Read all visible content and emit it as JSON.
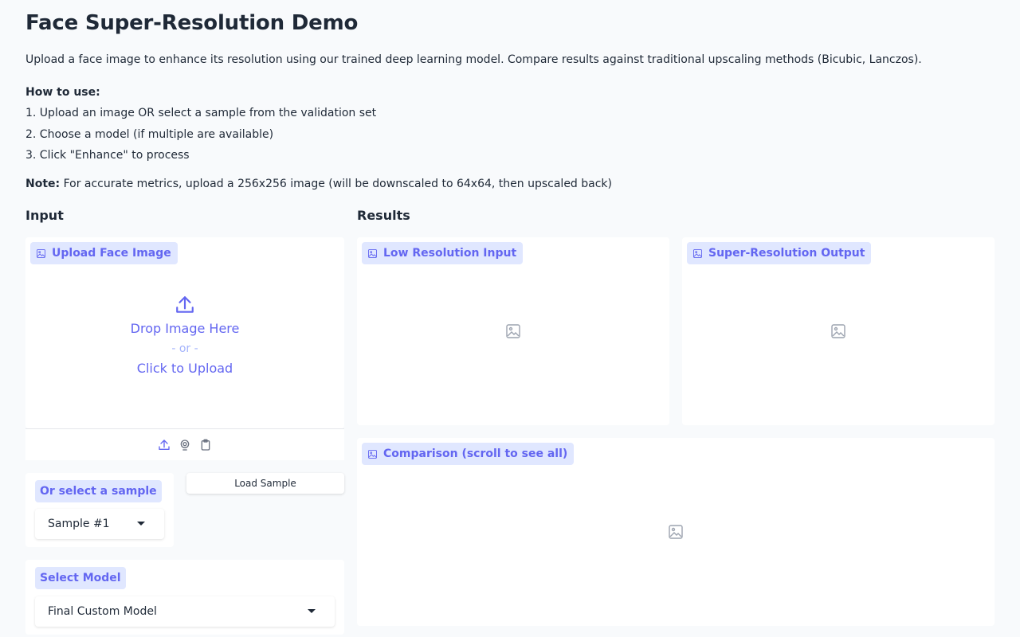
{
  "page": {
    "title": "Face Super-Resolution Demo",
    "intro": "Upload a face image to enhance its resolution using our trained deep learning model. Compare results against traditional upscaling methods (Bicubic, Lanczos).",
    "howto": {
      "heading": "How to use:",
      "steps": [
        "1. Upload an image OR select a sample from the validation set",
        "2. Choose a model (if multiple are available)",
        "3. Click \"Enhance\" to process"
      ]
    },
    "note": {
      "label": "Note:",
      "text": " For accurate metrics, upload a 256x256 image (will be downscaled to 64x64, then upscaled back)"
    }
  },
  "input": {
    "section_label": "Input",
    "upload": {
      "label": "Upload Face Image",
      "drop_main": "Drop Image Here",
      "drop_or": "- or -",
      "drop_click": "Click to Upload"
    },
    "toolbar": [
      "upload-icon",
      "webcam-icon",
      "clipboard-icon"
    ],
    "sample": {
      "label": "Or select a sample",
      "selected": "Sample #1",
      "load_button": "Load Sample"
    },
    "model": {
      "label": "Select Model",
      "selected": "Final Custom Model"
    }
  },
  "results": {
    "section_label": "Results",
    "low_res_label": "Low Resolution Input",
    "sr_label": "Super-Resolution Output",
    "comparison_label": "Comparison (scroll to see all)"
  },
  "colors": {
    "accent": "#6366f1",
    "badge_bg": "#e0e7ff",
    "background": "#f8fafc",
    "panel": "#ffffff",
    "text": "#1f2937"
  }
}
